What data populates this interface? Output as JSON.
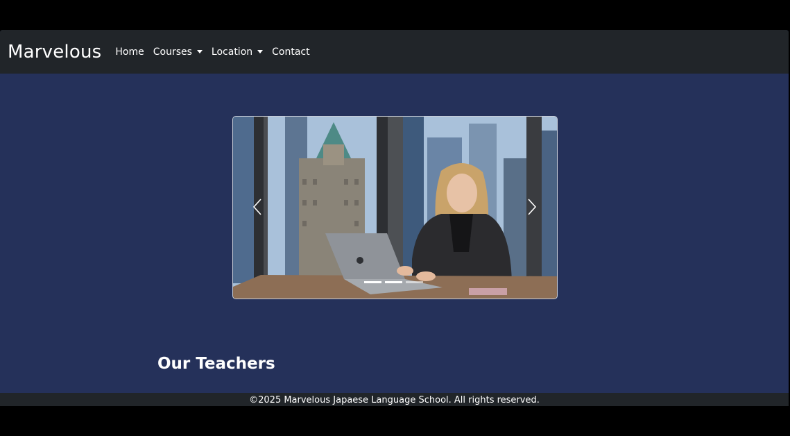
{
  "navbar": {
    "brand": "Marvelous",
    "items": [
      {
        "label": "Home",
        "dropdown": false
      },
      {
        "label": "Courses",
        "dropdown": true
      },
      {
        "label": "Location",
        "dropdown": true
      },
      {
        "label": "Contact",
        "dropdown": false
      }
    ]
  },
  "carousel": {
    "slide_count": 3,
    "active_index": 1,
    "prev_icon": "chevron-left-icon",
    "next_icon": "chevron-right-icon"
  },
  "section": {
    "title": "Our Teachers"
  },
  "footer": {
    "text": "©2025 Marvelous Japaese Language School. All rights reserved."
  },
  "colors": {
    "navbar_bg": "#212529",
    "page_bg": "#25315a",
    "text": "#ffffff"
  }
}
